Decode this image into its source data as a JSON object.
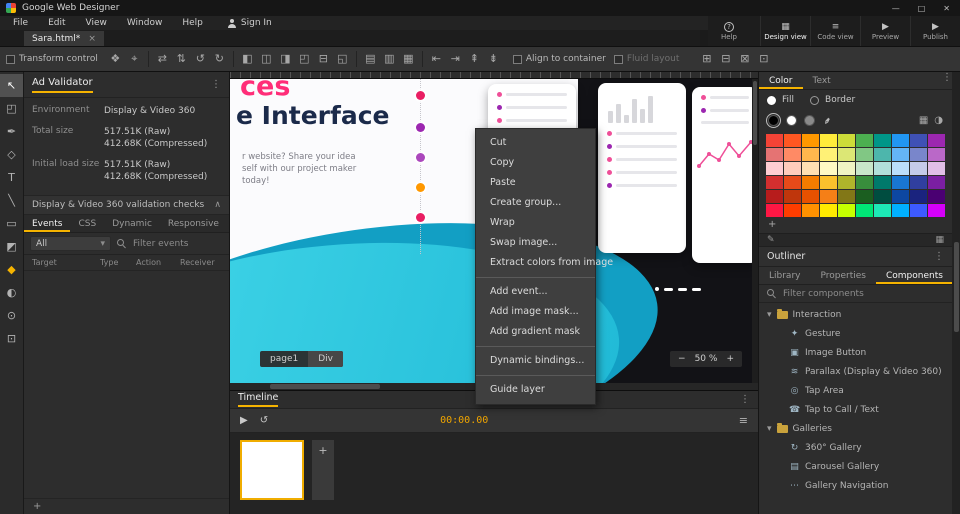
{
  "titlebar": {
    "title": "Google Web Designer",
    "minimize": "—",
    "maximize": "□",
    "close": "✕"
  },
  "menubar": {
    "items": [
      "File",
      "Edit",
      "View",
      "Window",
      "Help"
    ],
    "signin_label": "Sign In"
  },
  "tabbar": {
    "active_tab": "Sara.html*",
    "close_glyph": "×"
  },
  "view_controls": {
    "help": {
      "label": "Help",
      "glyph": "?"
    },
    "design": {
      "label": "Design view",
      "glyph": "▦"
    },
    "code": {
      "label": "Code view",
      "glyph": "≡"
    },
    "preview": {
      "label": "Preview",
      "glyph": "▶"
    },
    "publish": {
      "label": "Publish",
      "glyph": "▶"
    }
  },
  "toolbar": {
    "transform_label": "Transform control",
    "align_label": "Align to container",
    "fluid_label": "Fluid layout",
    "icons": [
      {
        "kind": "icon",
        "name": "free-transform-icon",
        "glyph": "❖"
      },
      {
        "kind": "icon",
        "name": "transform-origin-icon",
        "glyph": "⌖"
      },
      {
        "kind": "sep"
      },
      {
        "kind": "icon",
        "name": "flip-horizontal-icon",
        "glyph": "⇄"
      },
      {
        "kind": "icon",
        "name": "flip-vertical-icon",
        "glyph": "⇅"
      },
      {
        "kind": "icon",
        "name": "rotate-ccw-icon",
        "glyph": "↺"
      },
      {
        "kind": "icon",
        "name": "rotate-cw-icon",
        "glyph": "↻"
      },
      {
        "kind": "sep"
      },
      {
        "kind": "icon",
        "name": "align-left-icon",
        "glyph": "◧"
      },
      {
        "kind": "icon",
        "name": "align-center-horizontal-icon",
        "glyph": "◫"
      },
      {
        "kind": "icon",
        "name": "align-right-icon",
        "glyph": "◨"
      },
      {
        "kind": "icon",
        "name": "align-top-icon",
        "glyph": "◰"
      },
      {
        "kind": "icon",
        "name": "align-middle-icon",
        "glyph": "⊟"
      },
      {
        "kind": "icon",
        "name": "align-bottom-icon",
        "glyph": "◱"
      },
      {
        "kind": "sep"
      },
      {
        "kind": "icon",
        "name": "distribute-horizontal-icon",
        "glyph": "▤"
      },
      {
        "kind": "icon",
        "name": "distribute-vertical-icon",
        "glyph": "▥"
      },
      {
        "kind": "icon",
        "name": "distribute-grid-icon",
        "glyph": "▦"
      },
      {
        "kind": "sep"
      },
      {
        "kind": "icon",
        "name": "space-evenly-horizontal-icon",
        "glyph": "⇤"
      },
      {
        "kind": "icon",
        "name": "space-evenly-vertical-icon",
        "glyph": "⇥"
      },
      {
        "kind": "icon",
        "name": "match-width-icon",
        "glyph": "⇞"
      },
      {
        "kind": "icon",
        "name": "match-height-icon",
        "glyph": "⇟"
      }
    ],
    "right_icons": [
      {
        "kind": "icon",
        "name": "group-icon",
        "glyph": "⊞"
      },
      {
        "kind": "icon",
        "name": "ungroup-icon",
        "glyph": "⊟"
      },
      {
        "kind": "icon",
        "name": "bring-forward-icon",
        "glyph": "⊠"
      },
      {
        "kind": "icon",
        "name": "send-backward-icon",
        "glyph": "⊡"
      }
    ]
  },
  "tools": [
    {
      "name": "selection-tool",
      "glyph": "↖",
      "active": true
    },
    {
      "name": "3d-rotate-tool",
      "glyph": "◰"
    },
    {
      "name": "pen-tool",
      "glyph": "✒"
    },
    {
      "name": "tag-tool",
      "glyph": "◇"
    },
    {
      "name": "text-tool",
      "glyph": "T"
    },
    {
      "name": "line-tool",
      "glyph": "╲"
    },
    {
      "name": "shape-tool",
      "glyph": "▭"
    },
    {
      "name": "3d-stage-tool",
      "glyph": "◩"
    },
    {
      "name": "paint-bucket-tool",
      "glyph": "◆",
      "accent": true
    },
    {
      "name": "gradient-tool",
      "glyph": "◐"
    },
    {
      "name": "zoom-tool",
      "glyph": "⊙"
    },
    {
      "name": "fullscreen-preview-tool",
      "glyph": "⊡"
    }
  ],
  "ad_validator": {
    "title": "Ad Validator",
    "rows": [
      {
        "label": "Environment",
        "value": "Display & Video 360"
      },
      {
        "label": "Total size",
        "value": "517.51K (Raw)",
        "value2": "412.68K (Compressed)"
      },
      {
        "label": "Initial load size",
        "value": "517.51K (Raw)",
        "value2": "412.68K (Compressed)"
      }
    ],
    "checks_header": "Display & Video 360 validation checks"
  },
  "events_panel": {
    "tabs": [
      "Events",
      "CSS",
      "Dynamic",
      "Responsive"
    ],
    "scope_dropdown": "All",
    "filter_placeholder": "Filter events",
    "columns": [
      "Target",
      "Type",
      "Action",
      "Receiver"
    ],
    "add": "+"
  },
  "canvas": {
    "heading_accent": "ces",
    "heading": "e Interface",
    "body_lines": [
      "r website? Share your idea",
      "self with our project maker",
      "today!"
    ],
    "dot_colors": [
      "#e91e63",
      "#9c27b0",
      "#ab47bc",
      "#ff9800",
      "#e91e63"
    ],
    "breadcrumb": {
      "page": "page1",
      "element": "Div"
    },
    "zoom_out": "−",
    "zoom_level": "50 %",
    "zoom_in": "+"
  },
  "context_menu": {
    "items": [
      {
        "kind": "item",
        "label": "Cut"
      },
      {
        "kind": "item",
        "label": "Copy"
      },
      {
        "kind": "item",
        "label": "Paste"
      },
      {
        "kind": "item",
        "label": "Create group..."
      },
      {
        "kind": "item",
        "label": "Wrap"
      },
      {
        "kind": "item",
        "label": "Swap image..."
      },
      {
        "kind": "item",
        "label": "Extract colors from image"
      },
      {
        "kind": "sep"
      },
      {
        "kind": "item",
        "label": "Add event..."
      },
      {
        "kind": "item",
        "label": "Add image mask..."
      },
      {
        "kind": "item",
        "label": "Add gradient mask"
      },
      {
        "kind": "sep"
      },
      {
        "kind": "item",
        "label": "Dynamic bindings..."
      },
      {
        "kind": "sep"
      },
      {
        "kind": "item",
        "label": "Guide layer"
      }
    ]
  },
  "timeline": {
    "title": "Timeline",
    "time": "00:00.00",
    "play_glyph": "▶",
    "loop_glyph": "↺",
    "settings_glyph": "≡",
    "add_frame_glyph": "+"
  },
  "color_panel": {
    "tabs": [
      "Color",
      "Text"
    ],
    "fill_label": "Fill",
    "border_label": "Border",
    "chips": [
      {
        "color": "#000000",
        "selected": true
      },
      {
        "color": "#ffffff"
      },
      {
        "color": "#8a8a8a"
      }
    ],
    "palette": [
      "#f44336",
      "#ff5722",
      "#ff9800",
      "#ffeb3b",
      "#cddc39",
      "#4caf50",
      "#009688",
      "#2196f3",
      "#3f51b5",
      "#9c27b0",
      "#e57373",
      "#ff8a65",
      "#ffb74d",
      "#fff176",
      "#dce775",
      "#81c784",
      "#4db6ac",
      "#64b5f6",
      "#7986cb",
      "#ba68c8",
      "#ffcdd2",
      "#ffccbc",
      "#ffe0b2",
      "#fff9c4",
      "#f0f4c3",
      "#c8e6c9",
      "#b2dfdb",
      "#bbdefb",
      "#c5cae9",
      "#e1bee7",
      "#d32f2f",
      "#e64a19",
      "#f57c00",
      "#fbc02d",
      "#afb42b",
      "#388e3c",
      "#00796b",
      "#1976d2",
      "#303f9f",
      "#7b1fa2",
      "#b71c1c",
      "#bf360c",
      "#e65100",
      "#f57f17",
      "#827717",
      "#1b5e20",
      "#004d40",
      "#0d47a1",
      "#1a237e",
      "#4a0072",
      "#ff1744",
      "#ff3d00",
      "#ff9100",
      "#ffea00",
      "#c6ff00",
      "#00e676",
      "#1de9b6",
      "#00b0ff",
      "#3d5afe",
      "#d500f9"
    ],
    "add_label": "+"
  },
  "outliner": {
    "title": "Outliner"
  },
  "components_panel": {
    "tabs": [
      "Library",
      "Properties",
      "Components"
    ],
    "filter_placeholder": "Filter components",
    "tree": [
      {
        "kind": "folder",
        "caret": "▾",
        "label": "Interaction"
      },
      {
        "kind": "item",
        "glyph": "✦",
        "label": "Gesture"
      },
      {
        "kind": "item",
        "glyph": "▣",
        "label": "Image Button"
      },
      {
        "kind": "item",
        "glyph": "≋",
        "label": "Parallax (Display & Video 360)"
      },
      {
        "kind": "item",
        "glyph": "◎",
        "label": "Tap Area"
      },
      {
        "kind": "item",
        "glyph": "☎",
        "label": "Tap to Call / Text"
      },
      {
        "kind": "folder",
        "caret": "▾",
        "label": "Galleries"
      },
      {
        "kind": "item",
        "glyph": "↻",
        "label": "360° Gallery"
      },
      {
        "kind": "item",
        "glyph": "▤",
        "label": "Carousel Gallery"
      },
      {
        "kind": "item",
        "glyph": "⋯",
        "label": "Gallery Navigation"
      }
    ]
  }
}
